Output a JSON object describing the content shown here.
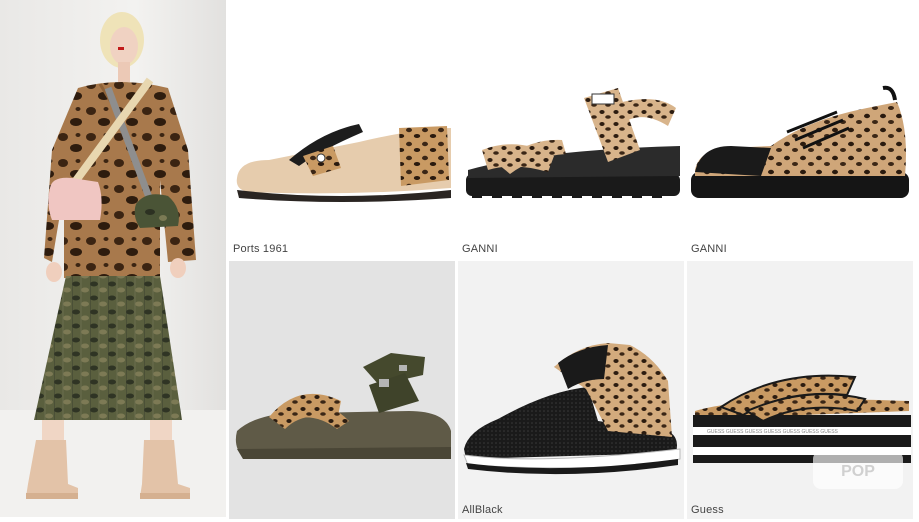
{
  "model_photo": {
    "palette": {
      "sweater": "#a8794c",
      "skirt": "#525a3c",
      "boots": "#e3c3a8",
      "bag": "#f0c6c2"
    }
  },
  "products": [
    {
      "brand": "Ports 1961",
      "style": "leopard-trim loafer"
    },
    {
      "brand": "GANNI",
      "style": "leopard strap sandal"
    },
    {
      "brand": "GANNI",
      "style": "leopard lace-up shoe"
    },
    {
      "brand": "",
      "style": "leopard and khaki strap sandal"
    },
    {
      "brand": "AllBlack",
      "style": "mesh sneaker with leopard panel"
    },
    {
      "brand": "Guess",
      "style": "leopard platform slide"
    }
  ],
  "watermark": "POP",
  "colors": {
    "leopard_base": "#c99a63",
    "leopard_spot": "#3a2616",
    "black": "#1a1a1a"
  }
}
